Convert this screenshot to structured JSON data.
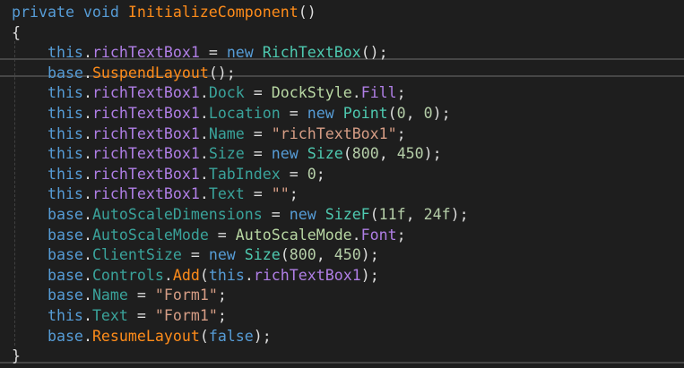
{
  "colors": {
    "background": "#1e1e1e",
    "keyword": "#569cd6",
    "method": "#ff8c1a",
    "field": "#b07fe6",
    "property": "#3aa39b",
    "type": "#4ec9b0",
    "enum": "#b8d7a3",
    "string": "#d69d85",
    "number": "#b5cea8",
    "text": "#dcdcdc"
  },
  "code": {
    "current_line": 4,
    "lines": [
      [
        {
          "t": "private void ",
          "k": "kw"
        },
        {
          "t": "InitializeComponent",
          "k": "method"
        },
        {
          "t": "()",
          "k": "punc"
        }
      ],
      [
        {
          "t": "{",
          "k": "punc"
        }
      ],
      [
        {
          "t": "    this",
          "k": "kw"
        },
        {
          "t": ".",
          "k": "punc"
        },
        {
          "t": "richTextBox1",
          "k": "field"
        },
        {
          "t": " = ",
          "k": "punc"
        },
        {
          "t": "new ",
          "k": "kw"
        },
        {
          "t": "RichTextBox",
          "k": "type"
        },
        {
          "t": "();",
          "k": "punc"
        }
      ],
      [
        {
          "t": "    base",
          "k": "kw"
        },
        {
          "t": ".",
          "k": "punc"
        },
        {
          "t": "SuspendLayout",
          "k": "method"
        },
        {
          "t": "();",
          "k": "punc"
        }
      ],
      [
        {
          "t": "    this",
          "k": "kw"
        },
        {
          "t": ".",
          "k": "punc"
        },
        {
          "t": "richTextBox1",
          "k": "field"
        },
        {
          "t": ".",
          "k": "punc"
        },
        {
          "t": "Dock",
          "k": "prop"
        },
        {
          "t": " = ",
          "k": "punc"
        },
        {
          "t": "DockStyle",
          "k": "enum"
        },
        {
          "t": ".",
          "k": "punc"
        },
        {
          "t": "Fill",
          "k": "field"
        },
        {
          "t": ";",
          "k": "punc"
        }
      ],
      [
        {
          "t": "    this",
          "k": "kw"
        },
        {
          "t": ".",
          "k": "punc"
        },
        {
          "t": "richTextBox1",
          "k": "field"
        },
        {
          "t": ".",
          "k": "punc"
        },
        {
          "t": "Location",
          "k": "prop"
        },
        {
          "t": " = ",
          "k": "punc"
        },
        {
          "t": "new ",
          "k": "kw"
        },
        {
          "t": "Point",
          "k": "type"
        },
        {
          "t": "(",
          "k": "punc"
        },
        {
          "t": "0",
          "k": "num"
        },
        {
          "t": ", ",
          "k": "punc"
        },
        {
          "t": "0",
          "k": "num"
        },
        {
          "t": ");",
          "k": "punc"
        }
      ],
      [
        {
          "t": "    this",
          "k": "kw"
        },
        {
          "t": ".",
          "k": "punc"
        },
        {
          "t": "richTextBox1",
          "k": "field"
        },
        {
          "t": ".",
          "k": "punc"
        },
        {
          "t": "Name",
          "k": "prop"
        },
        {
          "t": " = ",
          "k": "punc"
        },
        {
          "t": "\"richTextBox1\"",
          "k": "str"
        },
        {
          "t": ";",
          "k": "punc"
        }
      ],
      [
        {
          "t": "    this",
          "k": "kw"
        },
        {
          "t": ".",
          "k": "punc"
        },
        {
          "t": "richTextBox1",
          "k": "field"
        },
        {
          "t": ".",
          "k": "punc"
        },
        {
          "t": "Size",
          "k": "prop"
        },
        {
          "t": " = ",
          "k": "punc"
        },
        {
          "t": "new ",
          "k": "kw"
        },
        {
          "t": "Size",
          "k": "type"
        },
        {
          "t": "(",
          "k": "punc"
        },
        {
          "t": "800",
          "k": "num"
        },
        {
          "t": ", ",
          "k": "punc"
        },
        {
          "t": "450",
          "k": "num"
        },
        {
          "t": ");",
          "k": "punc"
        }
      ],
      [
        {
          "t": "    this",
          "k": "kw"
        },
        {
          "t": ".",
          "k": "punc"
        },
        {
          "t": "richTextBox1",
          "k": "field"
        },
        {
          "t": ".",
          "k": "punc"
        },
        {
          "t": "TabIndex",
          "k": "prop"
        },
        {
          "t": " = ",
          "k": "punc"
        },
        {
          "t": "0",
          "k": "num"
        },
        {
          "t": ";",
          "k": "punc"
        }
      ],
      [
        {
          "t": "    this",
          "k": "kw"
        },
        {
          "t": ".",
          "k": "punc"
        },
        {
          "t": "richTextBox1",
          "k": "field"
        },
        {
          "t": ".",
          "k": "punc"
        },
        {
          "t": "Text",
          "k": "prop"
        },
        {
          "t": " = ",
          "k": "punc"
        },
        {
          "t": "\"\"",
          "k": "str"
        },
        {
          "t": ";",
          "k": "punc"
        }
      ],
      [
        {
          "t": "    base",
          "k": "kw"
        },
        {
          "t": ".",
          "k": "punc"
        },
        {
          "t": "AutoScaleDimensions",
          "k": "prop"
        },
        {
          "t": " = ",
          "k": "punc"
        },
        {
          "t": "new ",
          "k": "kw"
        },
        {
          "t": "SizeF",
          "k": "type"
        },
        {
          "t": "(",
          "k": "punc"
        },
        {
          "t": "11f",
          "k": "num"
        },
        {
          "t": ", ",
          "k": "punc"
        },
        {
          "t": "24f",
          "k": "num"
        },
        {
          "t": ");",
          "k": "punc"
        }
      ],
      [
        {
          "t": "    base",
          "k": "kw"
        },
        {
          "t": ".",
          "k": "punc"
        },
        {
          "t": "AutoScaleMode",
          "k": "prop"
        },
        {
          "t": " = ",
          "k": "punc"
        },
        {
          "t": "AutoScaleMode",
          "k": "enum"
        },
        {
          "t": ".",
          "k": "punc"
        },
        {
          "t": "Font",
          "k": "field"
        },
        {
          "t": ";",
          "k": "punc"
        }
      ],
      [
        {
          "t": "    base",
          "k": "kw"
        },
        {
          "t": ".",
          "k": "punc"
        },
        {
          "t": "ClientSize",
          "k": "prop"
        },
        {
          "t": " = ",
          "k": "punc"
        },
        {
          "t": "new ",
          "k": "kw"
        },
        {
          "t": "Size",
          "k": "type"
        },
        {
          "t": "(",
          "k": "punc"
        },
        {
          "t": "800",
          "k": "num"
        },
        {
          "t": ", ",
          "k": "punc"
        },
        {
          "t": "450",
          "k": "num"
        },
        {
          "t": ");",
          "k": "punc"
        }
      ],
      [
        {
          "t": "    base",
          "k": "kw"
        },
        {
          "t": ".",
          "k": "punc"
        },
        {
          "t": "Controls",
          "k": "prop"
        },
        {
          "t": ".",
          "k": "punc"
        },
        {
          "t": "Add",
          "k": "method"
        },
        {
          "t": "(",
          "k": "punc"
        },
        {
          "t": "this",
          "k": "kw"
        },
        {
          "t": ".",
          "k": "punc"
        },
        {
          "t": "richTextBox1",
          "k": "field"
        },
        {
          "t": ");",
          "k": "punc"
        }
      ],
      [
        {
          "t": "    base",
          "k": "kw"
        },
        {
          "t": ".",
          "k": "punc"
        },
        {
          "t": "Name",
          "k": "prop"
        },
        {
          "t": " = ",
          "k": "punc"
        },
        {
          "t": "\"Form1\"",
          "k": "str"
        },
        {
          "t": ";",
          "k": "punc"
        }
      ],
      [
        {
          "t": "    this",
          "k": "kw"
        },
        {
          "t": ".",
          "k": "punc"
        },
        {
          "t": "Text",
          "k": "prop"
        },
        {
          "t": " = ",
          "k": "punc"
        },
        {
          "t": "\"Form1\"",
          "k": "str"
        },
        {
          "t": ";",
          "k": "punc"
        }
      ],
      [
        {
          "t": "    base",
          "k": "kw"
        },
        {
          "t": ".",
          "k": "punc"
        },
        {
          "t": "ResumeLayout",
          "k": "method"
        },
        {
          "t": "(",
          "k": "punc"
        },
        {
          "t": "false",
          "k": "kw"
        },
        {
          "t": ");",
          "k": "punc"
        }
      ],
      [
        {
          "t": "}",
          "k": "punc"
        }
      ]
    ]
  }
}
